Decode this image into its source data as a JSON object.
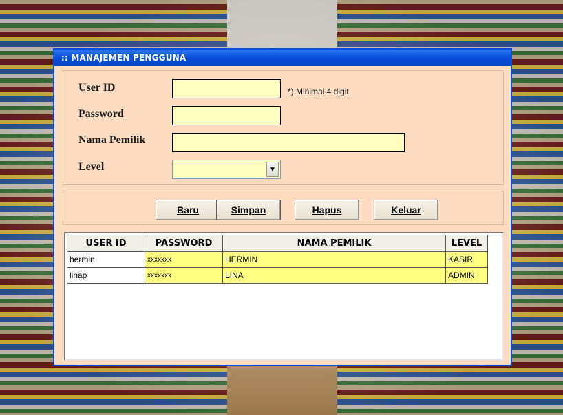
{
  "window": {
    "title": ":: MANAJEMEN PENGGUNA"
  },
  "form": {
    "user_id_label": "User ID",
    "user_id_hint": "*) Minimal 4 digit",
    "password_label": "Password",
    "nama_label": "Nama Pemilik",
    "level_label": "Level"
  },
  "buttons": {
    "baru": "Baru",
    "simpan": "Simpan",
    "hapus": "Hapus",
    "keluar": "Keluar"
  },
  "grid": {
    "headers": [
      "USER ID",
      "PASSWORD",
      "NAMA PEMILIK",
      "LEVEL"
    ],
    "rows": [
      [
        "hermin",
        "xxxxxxx",
        "HERMIN",
        "KASIR"
      ],
      [
        "linap",
        "xxxxxxx",
        "LINA",
        "ADMIN"
      ]
    ]
  }
}
